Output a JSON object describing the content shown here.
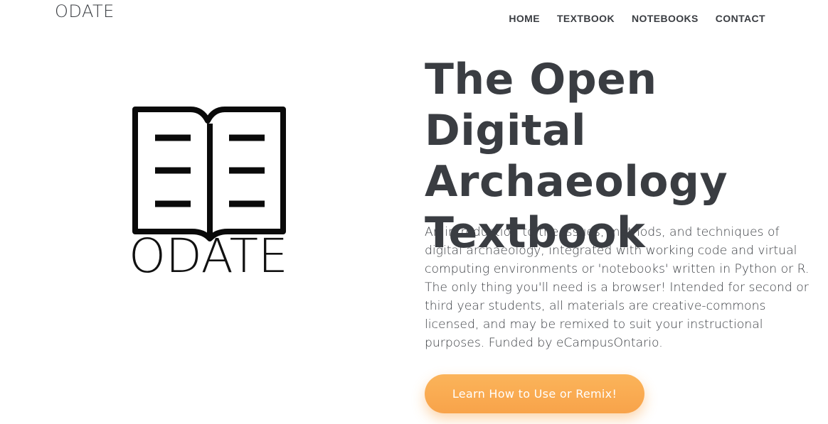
{
  "header": {
    "brand": "ODATE",
    "nav": [
      "HOME",
      "TEXTBOOK",
      "NOTEBOOKS",
      "CONTACT"
    ]
  },
  "logo": {
    "icon": "open-book-icon",
    "wordmark": "ODATE"
  },
  "hero": {
    "title": "The Open Digital Archaeology Textbook",
    "description": "An introduction to the issues, methods, and techniques of digital archaeology, integrated with working code and virtual computing environments or 'notebooks' written in Python or R. The only thing you'll need is a browser! Intended for second or third year students, all materials are creative-commons licensed, and may be remixed to suit your instructional purposes. Funded by eCampusOntario.",
    "cta_label": "Learn How to Use or Remix!"
  },
  "colors": {
    "text": "#3a3d42",
    "accent": "#f8a34a"
  }
}
